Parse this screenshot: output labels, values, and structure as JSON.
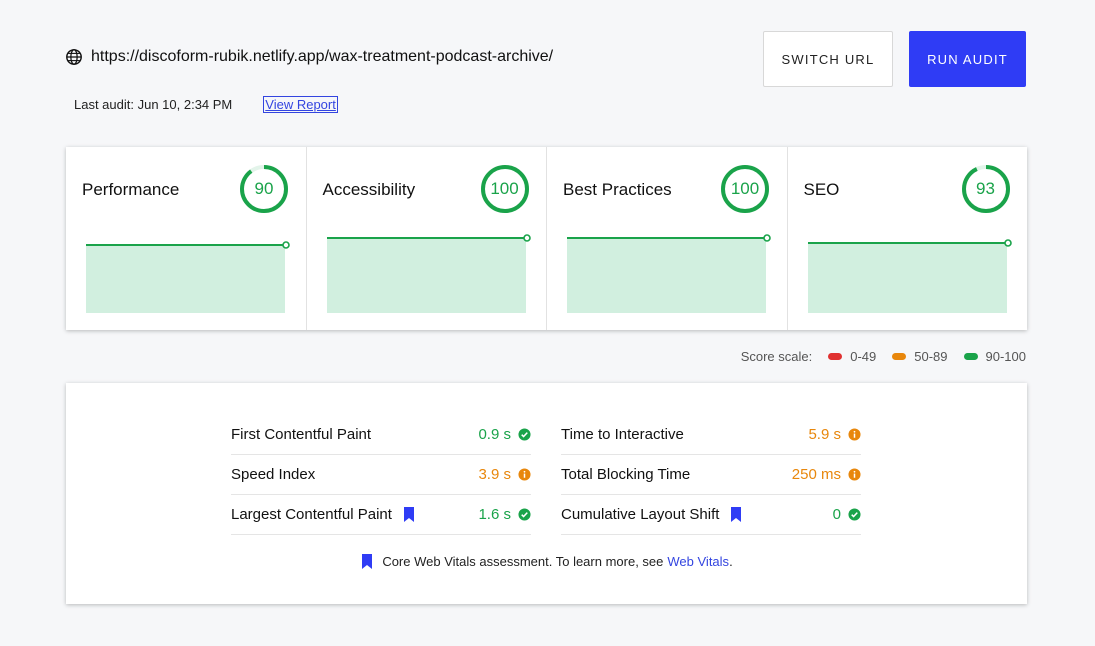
{
  "header": {
    "url": "https://discoform-rubik.netlify.app/wax-treatment-podcast-archive/",
    "last_audit": "Last audit: Jun 10, 2:34 PM",
    "view_report": "View Report",
    "switch_url": "SWITCH URL",
    "run_audit": "RUN AUDIT"
  },
  "colors": {
    "good": "#1aa34a",
    "mid": "#e8870c",
    "bad": "#e03131",
    "accent": "#2f3cf5"
  },
  "scores": [
    {
      "title": "Performance",
      "score": "90",
      "value": 90
    },
    {
      "title": "Accessibility",
      "score": "100",
      "value": 100
    },
    {
      "title": "Best Practices",
      "score": "100",
      "value": 100
    },
    {
      "title": "SEO",
      "score": "93",
      "value": 93
    }
  ],
  "scale": {
    "label": "Score scale:",
    "ranges": [
      "0-49",
      "50-89",
      "90-100"
    ]
  },
  "metrics": [
    {
      "name": "First Contentful Paint",
      "value": "0.9 s",
      "status": "good",
      "core": false
    },
    {
      "name": "Time to Interactive",
      "value": "5.9 s",
      "status": "mid",
      "core": false
    },
    {
      "name": "Speed Index",
      "value": "3.9 s",
      "status": "mid",
      "core": false
    },
    {
      "name": "Total Blocking Time",
      "value": "250 ms",
      "status": "mid",
      "core": false
    },
    {
      "name": "Largest Contentful Paint",
      "value": "1.6 s",
      "status": "good",
      "core": true
    },
    {
      "name": "Cumulative Layout Shift",
      "value": "0",
      "status": "good",
      "core": true
    }
  ],
  "footnote": {
    "text": "Core Web Vitals assessment. To learn more, see",
    "link": "Web Vitals",
    "end": "."
  }
}
